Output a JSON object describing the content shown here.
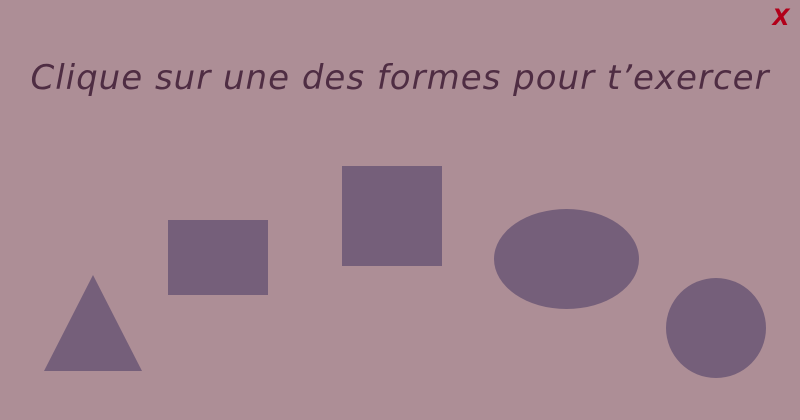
{
  "header": {
    "close_label": "X",
    "title": "Clique sur une des formes pour t’exercer"
  },
  "shapes": [
    {
      "kind": "triangle"
    },
    {
      "kind": "rectangle"
    },
    {
      "kind": "square"
    },
    {
      "kind": "ellipse"
    },
    {
      "kind": "circle"
    }
  ],
  "colors": {
    "background": "#ad8e96",
    "shape_fill": "#755f7a",
    "title_text": "#4f2d43",
    "close_icon": "#b2001a"
  }
}
